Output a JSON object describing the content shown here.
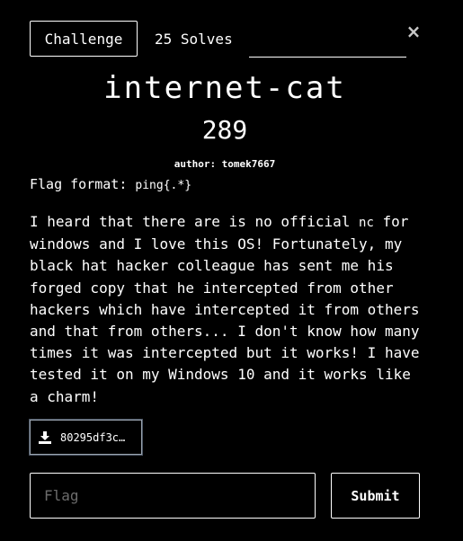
{
  "tabs": {
    "challenge_label": "Challenge",
    "solves_label": "25 Solves"
  },
  "close_icon": "×",
  "challenge": {
    "name": "internet-cat",
    "points": "289",
    "author": "author: tomek7667"
  },
  "flag_format": {
    "prefix": "Flag format: ",
    "code": "ping{.*}"
  },
  "description": {
    "part1": "I heard that there are is no official ",
    "code": "nc",
    "part2": " for windows and I love this OS! Fortunately, my black hat hacker colleague has sent me his forged copy that he intercepted from other hackers which have intercepted it from others and that from others... I don't know how many times it was intercepted but it works! I have tested it on my Windows 10 and it works like a charm!"
  },
  "file": {
    "icon": "download-icon",
    "name": "80295df3c…"
  },
  "flag_input": {
    "placeholder": "Flag",
    "value": ""
  },
  "submit_label": "Submit",
  "colors": {
    "background": "#000000",
    "text": "#ffffff",
    "placeholder": "#6c6c6c",
    "file_border": "#9aa4b0"
  }
}
